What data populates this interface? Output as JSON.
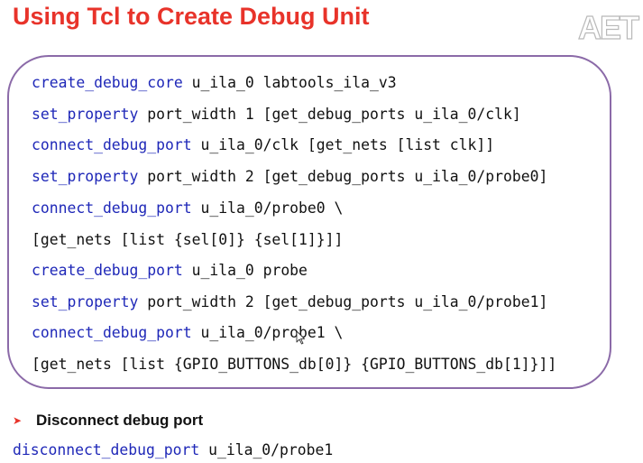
{
  "slide": {
    "title": "Using Tcl to Create Debug Unit",
    "logo_text": "AET"
  },
  "code_block": {
    "lines": [
      {
        "cmd": "create_debug_core",
        "args": " u_ila_0 labtools_ila_v3"
      },
      {
        "cmd": "set_property",
        "args": " port_width 1 [get_debug_ports u_ila_0/clk]"
      },
      {
        "cmd": "connect_debug_port",
        "args": " u_ila_0/clk [get_nets [list clk]]"
      },
      {
        "cmd": "set_property",
        "args": " port_width 2 [get_debug_ports u_ila_0/probe0]"
      },
      {
        "cmd": "connect_debug_port",
        "args": " u_ila_0/probe0 \\"
      },
      {
        "cmd": "",
        "args": "[get_nets [list {sel[0]} {sel[1]}]]"
      },
      {
        "cmd": "create_debug_port",
        "args": " u_ila_0 probe"
      },
      {
        "cmd": "set_property",
        "args": " port_width 2 [get_debug_ports u_ila_0/probe1]"
      },
      {
        "cmd": "connect_debug_port",
        "args": " u_ila_0/probe1 \\"
      },
      {
        "cmd": "",
        "args": "[get_nets [list {GPIO_BUTTONS_db[0]} {GPIO_BUTTONS_db[1]}]]"
      }
    ]
  },
  "bullet": {
    "icon": "arrow-bullet-icon",
    "text": "Disconnect debug port"
  },
  "bottom_code": {
    "cmd": "disconnect_debug_port",
    "args": " u_ila_0/probe1"
  },
  "colors": {
    "title": "#e8332a",
    "keyword": "#1f28b8",
    "box_border": "#8b6aa8"
  }
}
